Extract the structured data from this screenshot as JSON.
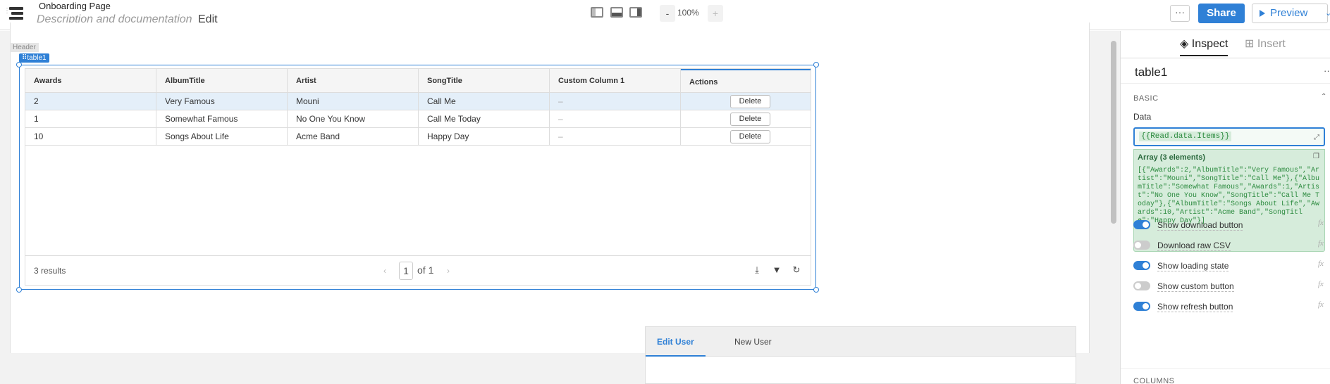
{
  "app": {
    "page_title": "Onboarding Page",
    "description_placeholder": "Description and documentation",
    "edit_label": "Edit"
  },
  "toolbar": {
    "zoom_minus": "-",
    "zoom_level": "100%",
    "zoom_plus": "+",
    "more": "···",
    "share": "Share",
    "preview": "Preview"
  },
  "canvas": {
    "header_label": "Header",
    "table_badge": "⠿table1"
  },
  "table": {
    "columns": [
      "Awards",
      "AlbumTitle",
      "Artist",
      "SongTitle",
      "Custom Column 1",
      "Actions"
    ],
    "rows": [
      {
        "awards": "2",
        "album": "Very Famous",
        "artist": "Mouni",
        "song": "Call Me",
        "custom": "–",
        "action": "Delete"
      },
      {
        "awards": "1",
        "album": "Somewhat Famous",
        "artist": "No One You Know",
        "song": "Call Me Today",
        "custom": "–",
        "action": "Delete"
      },
      {
        "awards": "10",
        "album": "Songs About Life",
        "artist": "Acme Band",
        "song": "Happy Day",
        "custom": "–",
        "action": "Delete"
      }
    ],
    "results": "3 results",
    "page_current": "1",
    "page_total": "of 1"
  },
  "tabs": {
    "items": [
      "Edit User",
      "New User"
    ]
  },
  "panel": {
    "tab_inspect": "Inspect",
    "tab_insert": "Insert",
    "component_name": "table1",
    "section_basic": "BASIC",
    "data_label": "Data",
    "data_value": "{{Read.data.Items}}",
    "eval_title": "Array (3 elements)",
    "eval_json": "[{\"Awards\":2,\"AlbumTitle\":\"Very Famous\",\"Artist\":\"Mouni\",\"SongTitle\":\"Call Me\"},{\"AlbumTitle\":\"Somewhat Famous\",\"Awards\":1,\"Artist\":\"No One You Know\",\"SongTitle\":\"Call Me Today\"},{\"AlbumTitle\":\"Songs About Life\",\"Awards\":10,\"Artist\":\"Acme Band\",\"SongTitle\":\"Happy Day\"}]",
    "toggles": [
      {
        "label": "Show download button",
        "on": true
      },
      {
        "label": "Download raw CSV",
        "on": false
      },
      {
        "label": "Show loading state",
        "on": true
      },
      {
        "label": "Show custom button",
        "on": false
      },
      {
        "label": "Show refresh button",
        "on": true
      }
    ],
    "fx_label": "fx",
    "section_columns": "COLUMNS"
  },
  "colors": {
    "accent": "#2f80d6",
    "selected_row": "#e4eff9",
    "eval_bg": "#d6ecdb"
  }
}
